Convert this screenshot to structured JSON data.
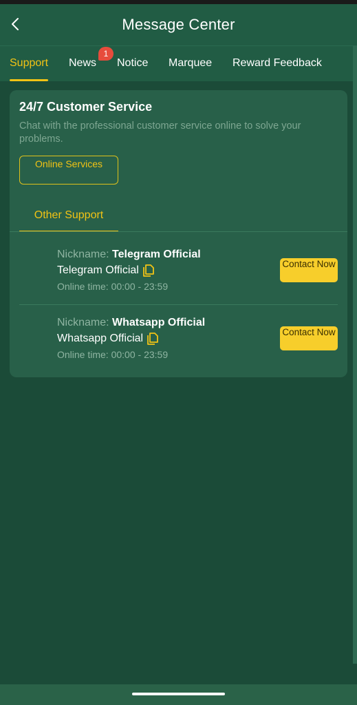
{
  "header": {
    "title": "Message Center",
    "back_icon": "chevron-left-icon"
  },
  "tabs": [
    {
      "label": "Support",
      "active": true
    },
    {
      "label": "News",
      "badge": "1"
    },
    {
      "label": "Notice"
    },
    {
      "label": "Marquee"
    },
    {
      "label": "Reward Feedback"
    }
  ],
  "customer_service": {
    "title": "24/7 Customer Service",
    "description": "Chat with the professional customer service online to solve your problems.",
    "online_button": "Online Services"
  },
  "other_support": {
    "tab_label": "Other Support",
    "contacts": [
      {
        "nickname_label": "Nickname:",
        "nickname": "Telegram Official",
        "account": "Telegram Official",
        "online_time_label": "Online time:",
        "online_time": "00:00 - 23:59",
        "button": "Contact Now"
      },
      {
        "nickname_label": "Nickname:",
        "nickname": "Whatsapp Official",
        "account": "Whatsapp Official",
        "online_time_label": "Online time:",
        "online_time": "00:00 - 23:59",
        "button": "Contact Now"
      }
    ]
  },
  "colors": {
    "background": "#1b4b38",
    "header": "#215c44",
    "card": "#286049",
    "accent": "#f2c315",
    "button": "#f7ce2b",
    "badge": "#e74c3c"
  }
}
